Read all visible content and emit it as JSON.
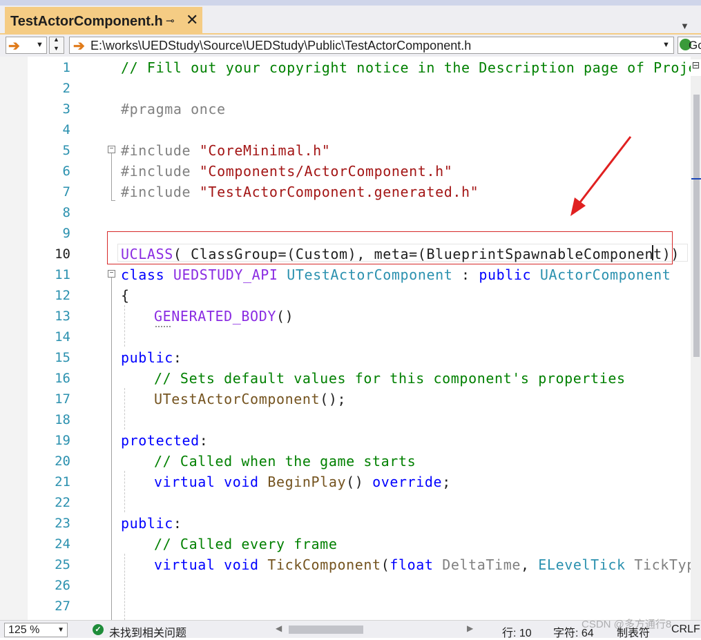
{
  "tab": {
    "title": "TestActorComponent.h",
    "pin_glyph": "⊸",
    "close_glyph": "✕"
  },
  "navbar": {
    "path": "E:\\works\\UEDStudy\\Source\\UEDStudy\\Public\\TestActorComponent.h",
    "go_label": "Go"
  },
  "editor": {
    "lines": [
      {
        "n": "1"
      },
      {
        "n": "2"
      },
      {
        "n": "3"
      },
      {
        "n": "4"
      },
      {
        "n": "5"
      },
      {
        "n": "6"
      },
      {
        "n": "7"
      },
      {
        "n": "8"
      },
      {
        "n": "9"
      },
      {
        "n": "10"
      },
      {
        "n": "11"
      },
      {
        "n": "12"
      },
      {
        "n": "13"
      },
      {
        "n": "14"
      },
      {
        "n": "15"
      },
      {
        "n": "16"
      },
      {
        "n": "17"
      },
      {
        "n": "18"
      },
      {
        "n": "19"
      },
      {
        "n": "20"
      },
      {
        "n": "21"
      },
      {
        "n": "22"
      },
      {
        "n": "23"
      },
      {
        "n": "24"
      },
      {
        "n": "25"
      },
      {
        "n": "26"
      },
      {
        "n": "27"
      }
    ],
    "code": {
      "l1": "// Fill out your copyright notice in the Description page of Project Settings.",
      "l3": "#pragma once",
      "l5_kw": "#include ",
      "l5_str": "\"CoreMinimal.h\"",
      "l6_kw": "#include ",
      "l6_str": "\"Components/ActorComponent.h\"",
      "l7_kw": "#include ",
      "l7_str": "\"TestActorComponent.generated.h\"",
      "l10_macro": "UCLASS",
      "l10_rest": "( ClassGroup=(Custom), meta=(BlueprintSpawnableComponent))",
      "l11_kw": "class ",
      "l11_api": "UEDSTUDY_API ",
      "l11_cls": "UTestActorComponent ",
      "l11_colon": ": ",
      "l11_pub": "public ",
      "l11_base": "UActorComponent",
      "l12": "{",
      "l13_macro": "GENERATED_BODY",
      "l13_paren": "()",
      "l15_kw": "public",
      "l15_colon": ":",
      "l16": "// Sets default values for this component's properties",
      "l17_fn": "UTestActorComponent",
      "l17_rest": "();",
      "l19_kw": "protected",
      "l19_colon": ":",
      "l20": "// Called when the game starts",
      "l21_kw": "virtual void ",
      "l21_fn": "BeginPlay",
      "l21_paren": "() ",
      "l21_ov": "override",
      "l21_semi": ";",
      "l23_kw": "public",
      "l23_colon": ":",
      "l24": "// Called every frame",
      "l25_kw": "virtual void ",
      "l25_fn": "TickComponent",
      "l25_p1": "(",
      "l25_float": "float ",
      "l25_dt": "DeltaTime",
      "l25_comma": ", ",
      "l25_tick": "ELevelTick ",
      "l25_tt": "TickType, FActorComponentTickFunction* ThisTickFunction) override;"
    }
  },
  "status": {
    "zoom": "125 %",
    "message": "未找到相关问题",
    "line": "行: 10",
    "char": "字符: 64",
    "tabs": "制表符",
    "eol": "CRLF"
  },
  "watermark": "CSDN @多方通行8",
  "colors": {
    "accent_tab": "#f5cc84",
    "annotation": "#d62828",
    "comment": "#008000",
    "keyword": "#0000ff",
    "string": "#a31515",
    "macro": "#8a2be2",
    "type": "#2b91af"
  }
}
